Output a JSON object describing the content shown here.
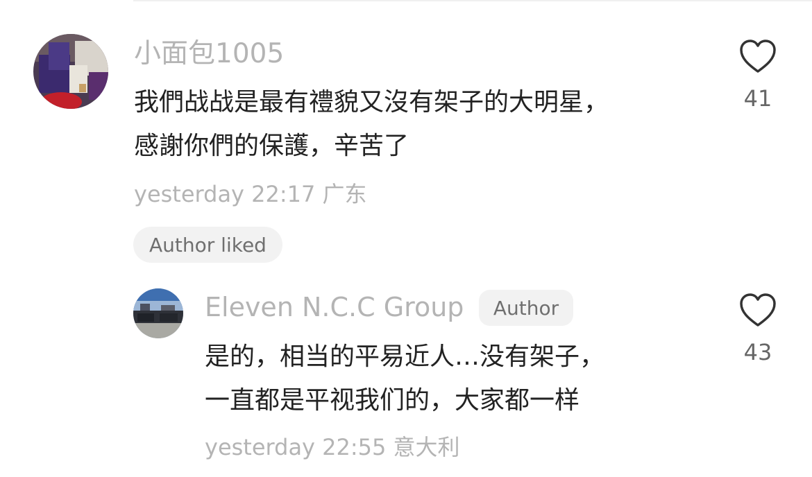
{
  "comments": [
    {
      "username": "小面包1005",
      "content_lines": [
        "我們战战是最有禮貌又沒有架子的大明星，",
        "感謝你們的保護，辛苦了"
      ],
      "time": "yesterday 22:17",
      "location": "广东",
      "author_liked_label": "Author liked",
      "like_count": "41",
      "avatar_icon": "avatar-photo-icon"
    },
    {
      "username": "Eleven N.C.C Group",
      "author_badge": "Author",
      "content_lines": [
        "是的，相当的平易近人…没有架子，",
        "一直都是平视我们的，大家都一样"
      ],
      "time": "yesterday 22:55",
      "location": "意大利",
      "like_count": "43",
      "avatar_icon": "avatar-photo-icon"
    }
  ],
  "icons": {
    "like": "heart-outline-icon"
  },
  "colors": {
    "meta_text": "#b4b4b4",
    "body_text": "#222222",
    "pill_bg": "#f2f2f2"
  }
}
